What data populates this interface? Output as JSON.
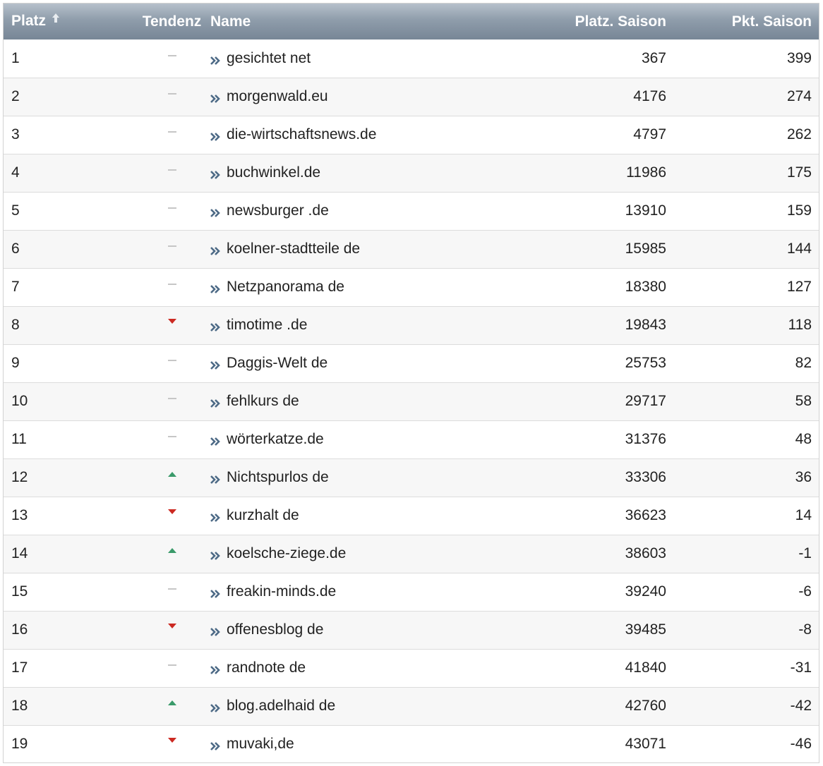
{
  "columns": {
    "platz": "Platz",
    "tendenz": "Tendenz",
    "name": "Name",
    "platz_saison": "Platz. Saison",
    "pkt_saison": "Pkt. Saison"
  },
  "colors": {
    "up": "#3a9a6a",
    "down": "#cc2a22",
    "same": "#c6c6c6",
    "chevron": "#4d6a86"
  },
  "rows": [
    {
      "platz": "1",
      "tendenz": "same",
      "name": "gesichtet net",
      "platz_saison": "367",
      "pkt_saison": "399"
    },
    {
      "platz": "2",
      "tendenz": "same",
      "name": "morgenwald.eu",
      "platz_saison": "4176",
      "pkt_saison": "274"
    },
    {
      "platz": "3",
      "tendenz": "same",
      "name": "die-wirtschaftsnews.de",
      "platz_saison": "4797",
      "pkt_saison": "262"
    },
    {
      "platz": "4",
      "tendenz": "same",
      "name": "buchwinkel.de",
      "platz_saison": "11986",
      "pkt_saison": "175"
    },
    {
      "platz": "5",
      "tendenz": "same",
      "name": "newsburger .de",
      "platz_saison": "13910",
      "pkt_saison": "159"
    },
    {
      "platz": "6",
      "tendenz": "same",
      "name": "koelner-stadtteile de",
      "platz_saison": "15985",
      "pkt_saison": "144"
    },
    {
      "platz": "7",
      "tendenz": "same",
      "name": "Netzpanorama de",
      "platz_saison": "18380",
      "pkt_saison": "127"
    },
    {
      "platz": "8",
      "tendenz": "down",
      "name": "timotime .de",
      "platz_saison": "19843",
      "pkt_saison": "118"
    },
    {
      "platz": "9",
      "tendenz": "same",
      "name": "Daggis-Welt de",
      "platz_saison": "25753",
      "pkt_saison": "82"
    },
    {
      "platz": "10",
      "tendenz": "same",
      "name": "fehlkurs de",
      "platz_saison": "29717",
      "pkt_saison": "58"
    },
    {
      "platz": "11",
      "tendenz": "same",
      "name": "wörterkatze.de",
      "platz_saison": "31376",
      "pkt_saison": "48"
    },
    {
      "platz": "12",
      "tendenz": "up",
      "name": "Nichtspurlos de",
      "platz_saison": "33306",
      "pkt_saison": "36"
    },
    {
      "platz": "13",
      "tendenz": "down",
      "name": "kurzhalt de",
      "platz_saison": "36623",
      "pkt_saison": "14"
    },
    {
      "platz": "14",
      "tendenz": "up",
      "name": "koelsche-ziege.de",
      "platz_saison": "38603",
      "pkt_saison": "-1"
    },
    {
      "platz": "15",
      "tendenz": "same",
      "name": "freakin-minds.de",
      "platz_saison": "39240",
      "pkt_saison": "-6"
    },
    {
      "platz": "16",
      "tendenz": "down",
      "name": "offenesblog de",
      "platz_saison": "39485",
      "pkt_saison": "-8"
    },
    {
      "platz": "17",
      "tendenz": "same",
      "name": "randnote de",
      "platz_saison": "41840",
      "pkt_saison": "-31"
    },
    {
      "platz": "18",
      "tendenz": "up",
      "name": "blog.adelhaid de",
      "platz_saison": "42760",
      "pkt_saison": "-42"
    },
    {
      "platz": "19",
      "tendenz": "down",
      "name": "muvaki,de",
      "platz_saison": "43071",
      "pkt_saison": "-46"
    }
  ]
}
